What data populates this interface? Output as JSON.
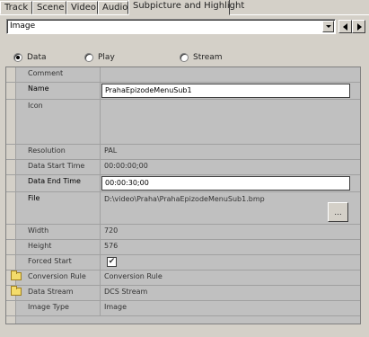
{
  "tabs": [
    {
      "label": "Track",
      "active": false
    },
    {
      "label": "Scene",
      "active": false
    },
    {
      "label": "Video",
      "active": false
    },
    {
      "label": "Audio",
      "active": false
    },
    {
      "label": "Subpicture and Highlight",
      "active": true
    }
  ],
  "selector": {
    "value": "Image"
  },
  "radios": [
    {
      "label": "Data",
      "selected": true
    },
    {
      "label": "Play",
      "selected": false
    },
    {
      "label": "Stream",
      "selected": false
    }
  ],
  "properties": {
    "comment": {
      "name": "Comment",
      "value": ""
    },
    "name": {
      "name": "Name",
      "value": "PrahaEpizodeMenuSub1"
    },
    "icon": {
      "name": "Icon"
    },
    "resolution": {
      "name": "Resolution",
      "value": "PAL"
    },
    "data_start_time": {
      "name": "Data Start Time",
      "value": "00:00:00;00"
    },
    "data_end_time": {
      "name": "Data End Time",
      "value": "00:00:30;00"
    },
    "file": {
      "name": "File",
      "value": "D:\\video\\Praha\\PrahaEpizodeMenuSub1.bmp",
      "browse_label": "..."
    },
    "width": {
      "name": "Width",
      "value": "720"
    },
    "height": {
      "name": "Height",
      "value": "576"
    },
    "forced_start": {
      "name": "Forced Start",
      "checked": true,
      "check_glyph": "✔"
    },
    "conversion_rule": {
      "name": "Conversion Rule",
      "value": "Conversion Rule"
    },
    "data_stream": {
      "name": "Data Stream",
      "value": "DCS Stream"
    },
    "image_type": {
      "name": "Image Type",
      "value": "Image"
    }
  },
  "colors": {
    "background": "#d4d0c8",
    "grid": "#c0c0c0",
    "folder": "#f4dc6b"
  },
  "icons": [
    "chevron-down-icon",
    "arrow-left-icon",
    "arrow-right-icon",
    "folder-icon",
    "checkbox-icon",
    "image-preview-icon"
  ]
}
